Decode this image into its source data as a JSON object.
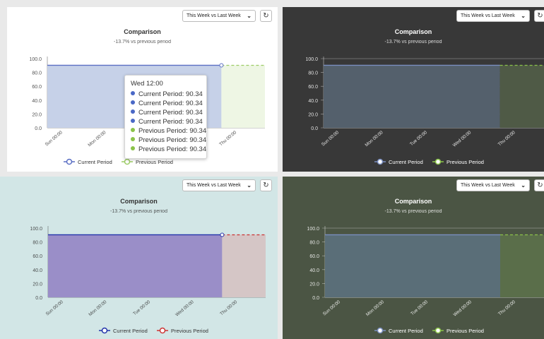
{
  "controls": {
    "period_select": "This Week vs Last Week",
    "refresh_icon": "refresh-icon"
  },
  "tooltip": {
    "title": "Wed 12:00",
    "rows": [
      {
        "label": "Current Period: 90.34",
        "series": "current"
      },
      {
        "label": "Current Period: 90.34",
        "series": "current"
      },
      {
        "label": "Current Period: 90.34",
        "series": "current"
      },
      {
        "label": "Current Period: 90.34",
        "series": "current"
      },
      {
        "label": "Previous Period: 90.34",
        "series": "previous"
      },
      {
        "label": "Previous Period: 90.34",
        "series": "previous"
      },
      {
        "label": "Previous Period: 90.34",
        "series": "previous"
      }
    ]
  },
  "chart_data": [
    {
      "type": "area",
      "theme": "light",
      "title": "Comparison",
      "subtitle": "-13.7% vs previous period",
      "x": [
        "Sun 00:00",
        "Mon 00:00",
        "Tue 00:00",
        "Wed 00:00",
        "Thu 00:00"
      ],
      "ylim": [
        0,
        100
      ],
      "yticks": [
        "100.0",
        "80.0",
        "60.0",
        "40.0",
        "20.0",
        "0.0"
      ],
      "grid": false,
      "legend_position": "bottom",
      "colors": {
        "background": "#ffffff",
        "text": "#333333",
        "current_fill": "#c6d1e8",
        "current_line": "#5b6fc4",
        "previous_fill": "#eef6e4",
        "previous_line": "#9ccc65"
      },
      "series": [
        {
          "name": "Current Period",
          "values": [
            90.34,
            90.34,
            90.34,
            90.34
          ],
          "marker": "hollow",
          "dash": false
        },
        {
          "name": "Previous Period",
          "values": [
            90.34,
            90.34
          ],
          "marker": "hollow",
          "dash": true
        }
      ]
    },
    {
      "type": "area",
      "theme": "dark",
      "title": "Comparison",
      "subtitle": "-13.7% vs previous period",
      "x": [
        "Sun 00:00",
        "Mon 00:00",
        "Tue 00:00",
        "Wed 00:00",
        "Thu 00:00"
      ],
      "ylim": [
        0,
        100
      ],
      "yticks": [
        "100.0",
        "80.0",
        "60.0",
        "40.0",
        "20.0",
        "0.0"
      ],
      "grid": true,
      "legend_position": "bottom",
      "colors": {
        "background": "#383838",
        "text": "#ffffff",
        "current_fill": "#54606c",
        "current_line": "#7a8ec0",
        "previous_fill": "#4f5a46",
        "previous_line": "#8bc34a"
      },
      "series": [
        {
          "name": "Current Period",
          "values": [
            90.34,
            90.34,
            90.34,
            90.34
          ],
          "marker": "filled",
          "dash": false
        },
        {
          "name": "Previous Period",
          "values": [
            90.34,
            90.34
          ],
          "marker": "filled",
          "dash": true
        }
      ]
    },
    {
      "type": "area",
      "theme": "teal",
      "title": "Comparison",
      "subtitle": "-13.7% vs previous period",
      "x": [
        "Sun 00:00",
        "Mon 00:00",
        "Tue 00:00",
        "Wed 00:00",
        "Thu 00:00"
      ],
      "ylim": [
        0,
        100
      ],
      "yticks": [
        "100.0",
        "80.0",
        "60.0",
        "40.0",
        "20.0",
        "0.0"
      ],
      "grid": false,
      "legend_position": "bottom",
      "colors": {
        "background": "#d2e6e6",
        "text": "#333333",
        "current_fill": "#9a8ec8",
        "current_line": "#2233aa",
        "previous_fill": "#d5c6c6",
        "previous_line": "#cc3333"
      },
      "series": [
        {
          "name": "Current Period",
          "values": [
            90.34,
            90.34,
            90.34,
            90.34
          ],
          "marker": "hollow",
          "dash": false
        },
        {
          "name": "Previous Period",
          "values": [
            90.34,
            90.34
          ],
          "marker": "hollow",
          "dash": true
        }
      ]
    },
    {
      "type": "area",
      "theme": "olive",
      "title": "Comparison",
      "subtitle": "-13.7% vs previous period",
      "x": [
        "Sun 00:00",
        "Mon 00:00",
        "Tue 00:00",
        "Wed 00:00",
        "Thu 00:00"
      ],
      "ylim": [
        0,
        100
      ],
      "yticks": [
        "100.0",
        "80.0",
        "60.0",
        "40.0",
        "20.0",
        "0.0"
      ],
      "grid": true,
      "legend_position": "bottom",
      "colors": {
        "background": "#4b5544",
        "text": "#ffffff",
        "current_fill": "#5a6e78",
        "current_line": "#7a8ec0",
        "previous_fill": "#5a6e4a",
        "previous_line": "#8bc34a"
      },
      "series": [
        {
          "name": "Current Period",
          "values": [
            90.34,
            90.34,
            90.34,
            90.34
          ],
          "marker": "filled",
          "dash": false
        },
        {
          "name": "Previous Period",
          "values": [
            90.34,
            90.34
          ],
          "marker": "filled",
          "dash": true
        }
      ]
    }
  ]
}
